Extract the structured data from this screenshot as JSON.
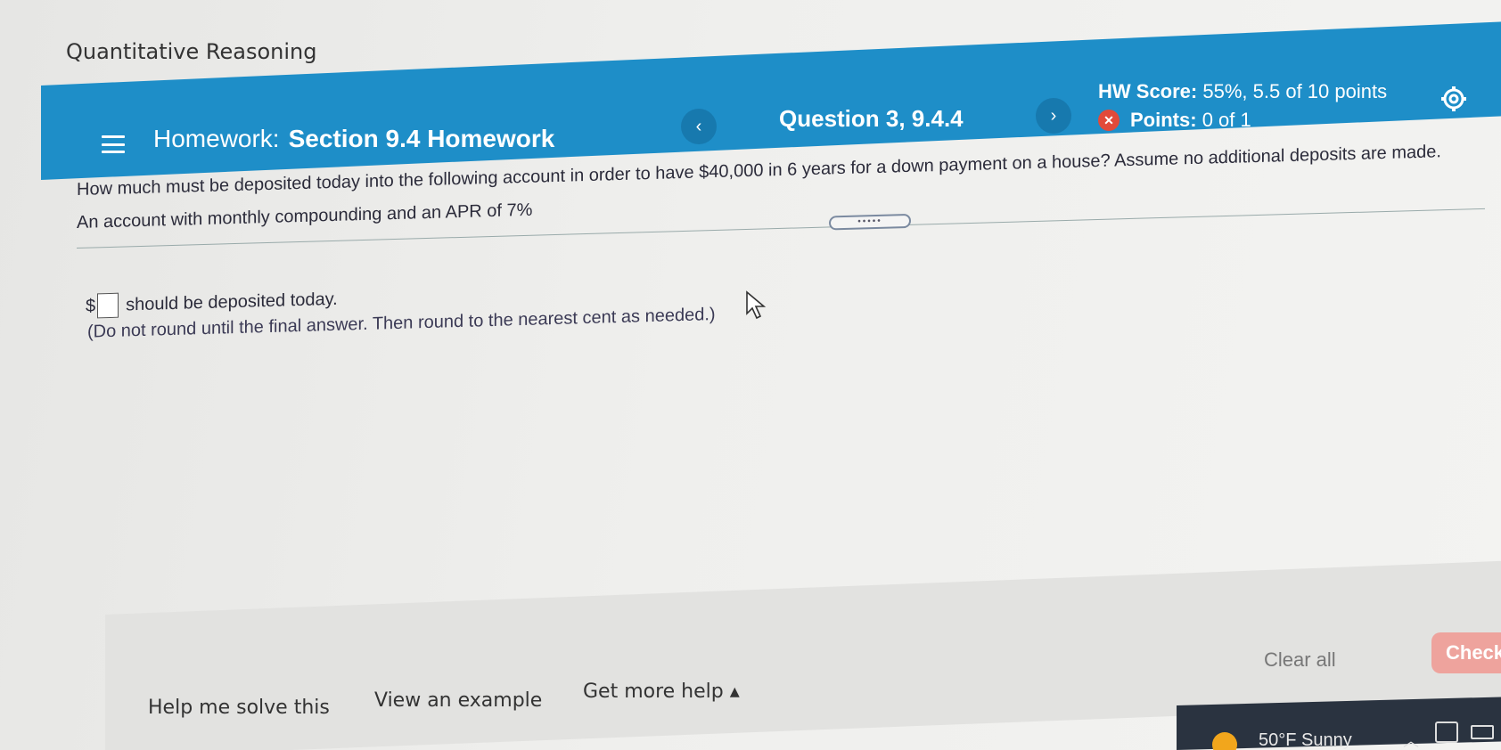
{
  "course": {
    "title": "Quantitative Reasoning"
  },
  "header": {
    "homework_prefix": "Homework:",
    "homework_section": "Section 9.4 Homework",
    "question_label": "Question 3, 9.4.4",
    "prev_icon": "chevron-left-icon",
    "next_icon": "chevron-right-icon",
    "hw_score_label": "HW Score:",
    "hw_score_value": "55%, 5.5 of 10 points",
    "points_label": "Points:",
    "points_value": "0 of 1",
    "accent_color": "#1e8ec8"
  },
  "question": {
    "text": "How much must be deposited today into the following account in order to have $40,000 in 6  years for a down payment on a house? Assume no additional deposits are made.",
    "account": "An account with monthly compounding and an APR of 7%",
    "expand_label": "•••••",
    "currency": "$",
    "answer_value": "",
    "answer_suffix": "should be deposited today.",
    "hint": "(Do not round until the final answer. Then round to the nearest cent as needed.)"
  },
  "footer": {
    "help_me_solve": "Help me solve this",
    "view_example": "View an example",
    "get_more_help": "Get more help ▴",
    "clear_all": "Clear all",
    "check": "Check",
    "check_color": "#eea39d"
  },
  "taskbar": {
    "weather": "50°F  Sunny"
  }
}
